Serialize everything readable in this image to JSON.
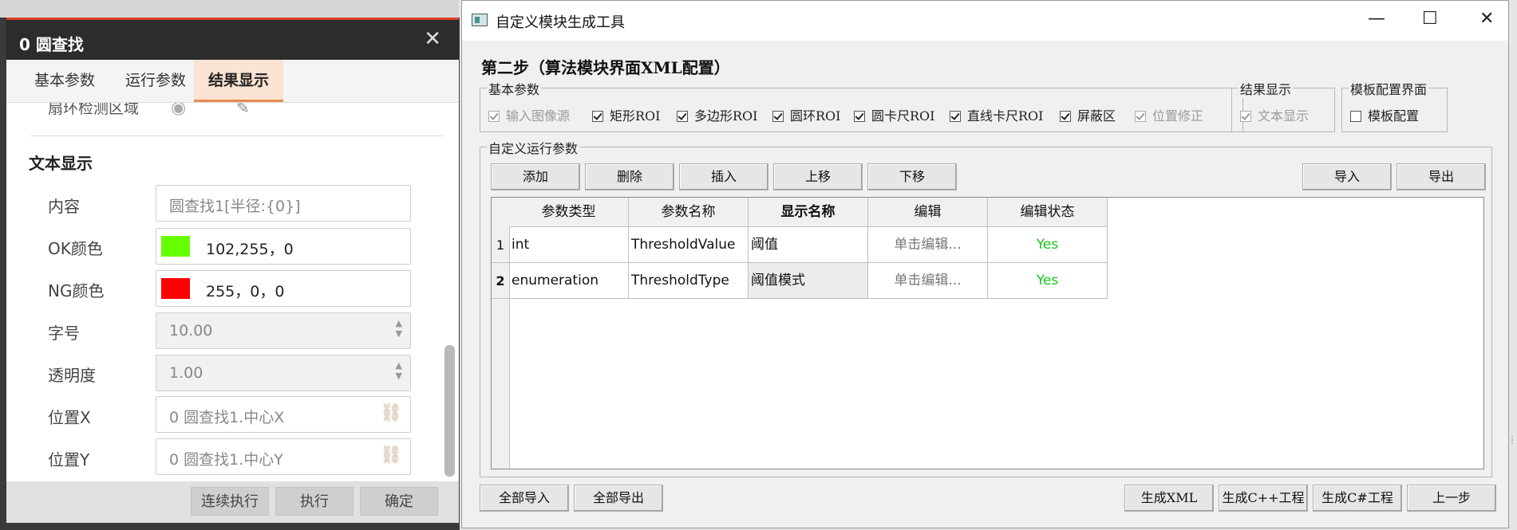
{
  "left_panel": {
    "title": "0 圆查找",
    "close_icon": "✕",
    "tabs": [
      "基本参数",
      "运行参数",
      "结果显示"
    ],
    "cut_label": "扇环检测区域",
    "section_title": "文本显示",
    "fields": {
      "content": {
        "label": "内容",
        "placeholder": "圆查找1[半径:{0}]"
      },
      "ok_color": {
        "label": "OK颜色",
        "value": "102,255，0",
        "swatch": "#66ff00"
      },
      "ng_color": {
        "label": "NG颜色",
        "value": "255，0，0",
        "swatch": "#ff0000"
      },
      "font_size": {
        "label": "字号",
        "value": "10.00"
      },
      "opacity": {
        "label": "透明度",
        "value": "1.00"
      },
      "pos_x": {
        "label": "位置X",
        "value": "0 圆查找1.中心X"
      },
      "pos_y": {
        "label": "位置Y",
        "value": "0 圆查找1.中心Y"
      }
    },
    "buttons": {
      "run_continuous": "连续执行",
      "run": "执行",
      "ok": "确定"
    }
  },
  "window": {
    "title": "自定义模块生成工具",
    "step_title": "第二步（算法模块界面XML配置）",
    "basic_group": {
      "title": "基本参数",
      "items": [
        {
          "label": "输入图像源",
          "checked": true,
          "disabled": true
        },
        {
          "label": "矩形ROI",
          "checked": true,
          "disabled": false
        },
        {
          "label": "多边形ROI",
          "checked": true,
          "disabled": false
        },
        {
          "label": "圆环ROI",
          "checked": true,
          "disabled": false
        },
        {
          "label": "圆卡尺ROI",
          "checked": true,
          "disabled": false
        },
        {
          "label": "直线卡尺ROI",
          "checked": true,
          "disabled": false
        },
        {
          "label": "屏蔽区",
          "checked": true,
          "disabled": false
        },
        {
          "label": "位置修正",
          "checked": true,
          "disabled": true
        }
      ]
    },
    "result_group": {
      "title": "结果显示",
      "item": {
        "label": "文本显示",
        "checked": true,
        "disabled": true
      }
    },
    "template_group": {
      "title": "模板配置界面",
      "item": {
        "label": "模板配置",
        "checked": false,
        "disabled": false
      }
    },
    "run_group": {
      "title": "自定义运行参数",
      "buttons": {
        "add": "添加",
        "delete": "删除",
        "insert": "插入",
        "up": "上移",
        "down": "下移",
        "import": "导入",
        "export": "导出"
      },
      "columns": [
        "参数类型",
        "参数名称",
        "显示名称",
        "编辑",
        "编辑状态"
      ],
      "rows": [
        {
          "index": "1",
          "type": "int",
          "name": "ThresholdValue",
          "display": "阈值",
          "edit": "单击编辑...",
          "status": "Yes"
        },
        {
          "index": "2",
          "type": "enumeration",
          "name": "ThresholdType",
          "display": "阈值模式",
          "edit": "单击编辑...",
          "status": "Yes"
        }
      ]
    },
    "bottom_buttons": {
      "import_all": "全部导入",
      "export_all": "全部导出",
      "gen_xml": "生成XML",
      "gen_cpp": "生成C++工程",
      "gen_cs": "生成C#工程",
      "prev": "上一步"
    },
    "controls": {
      "minimize": "—",
      "maximize": "☐",
      "close": "✕"
    }
  }
}
